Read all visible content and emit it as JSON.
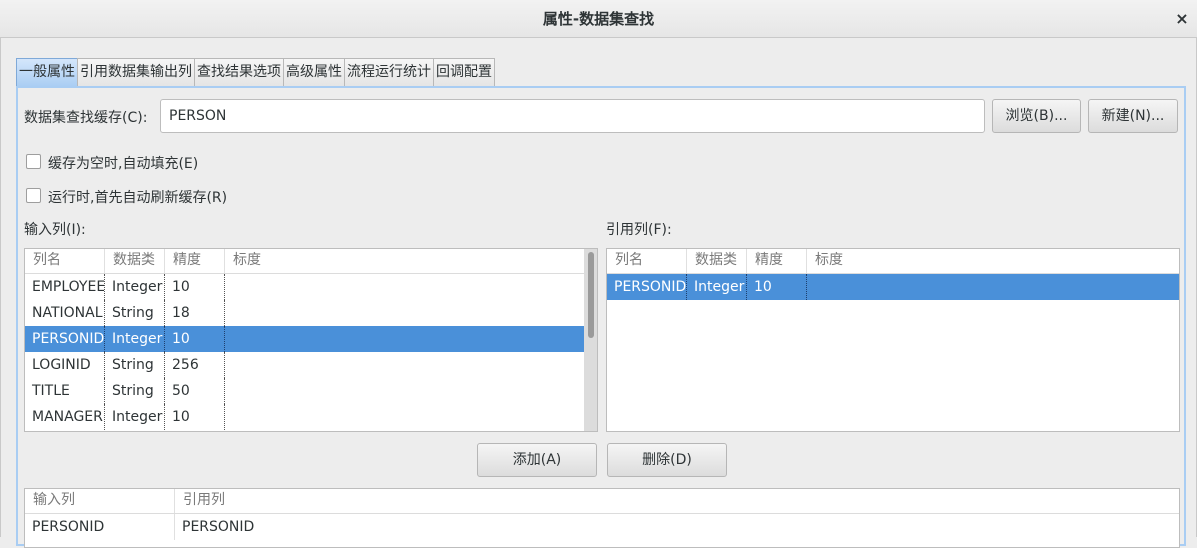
{
  "window": {
    "title": "属性-数据集查找",
    "close_glyph": "×"
  },
  "tabs": [
    {
      "label": "一般属性",
      "active": true
    },
    {
      "label": "引用数据集输出列",
      "active": false
    },
    {
      "label": "查找结果选项",
      "active": false
    },
    {
      "label": "高级属性",
      "active": false
    },
    {
      "label": "流程运行统计",
      "active": false
    },
    {
      "label": "回调配置",
      "active": false
    }
  ],
  "cache": {
    "label": "数据集查找缓存(C):",
    "value": "PERSON",
    "browse_label": "浏览(B)...",
    "new_label": "新建(N)..."
  },
  "options": {
    "auto_fill_label": "缓存为空时,自动填充(E)",
    "auto_fill_checked": false,
    "auto_refresh_label": "运行时,首先自动刷新缓存(R)",
    "auto_refresh_checked": false
  },
  "input_columns": {
    "label": "输入列(I):",
    "headers": [
      "列名",
      "数据类",
      "精度",
      "标度"
    ],
    "rows": [
      {
        "name": "EMPLOYEE",
        "type": "Integer",
        "precision": "10",
        "scale": "",
        "selected": false
      },
      {
        "name": "NATIONAL",
        "type": "String",
        "precision": "18",
        "scale": "",
        "selected": false
      },
      {
        "name": "PERSONID",
        "type": "Integer",
        "precision": "10",
        "scale": "",
        "selected": true
      },
      {
        "name": "LOGINID",
        "type": "String",
        "precision": "256",
        "scale": "",
        "selected": false
      },
      {
        "name": "TITLE",
        "type": "String",
        "precision": "50",
        "scale": "",
        "selected": false
      },
      {
        "name": "MANAGERI",
        "type": "Integer",
        "precision": "10",
        "scale": "",
        "selected": false
      }
    ]
  },
  "ref_columns": {
    "label": "引用列(F):",
    "headers": [
      "列名",
      "数据类",
      "精度",
      "标度"
    ],
    "rows": [
      {
        "name": "PERSONID",
        "type": "Integer",
        "precision": "10",
        "scale": "",
        "selected": true
      }
    ]
  },
  "actions": {
    "add_label": "添加(A)",
    "delete_label": "删除(D)"
  },
  "mapping": {
    "headers": [
      "输入列",
      "引用列"
    ],
    "rows": [
      {
        "input": "PERSONID",
        "ref": "PERSONID"
      }
    ]
  },
  "colors": {
    "selection": "#4a90d9",
    "tab_active": "#a9cdf3"
  }
}
